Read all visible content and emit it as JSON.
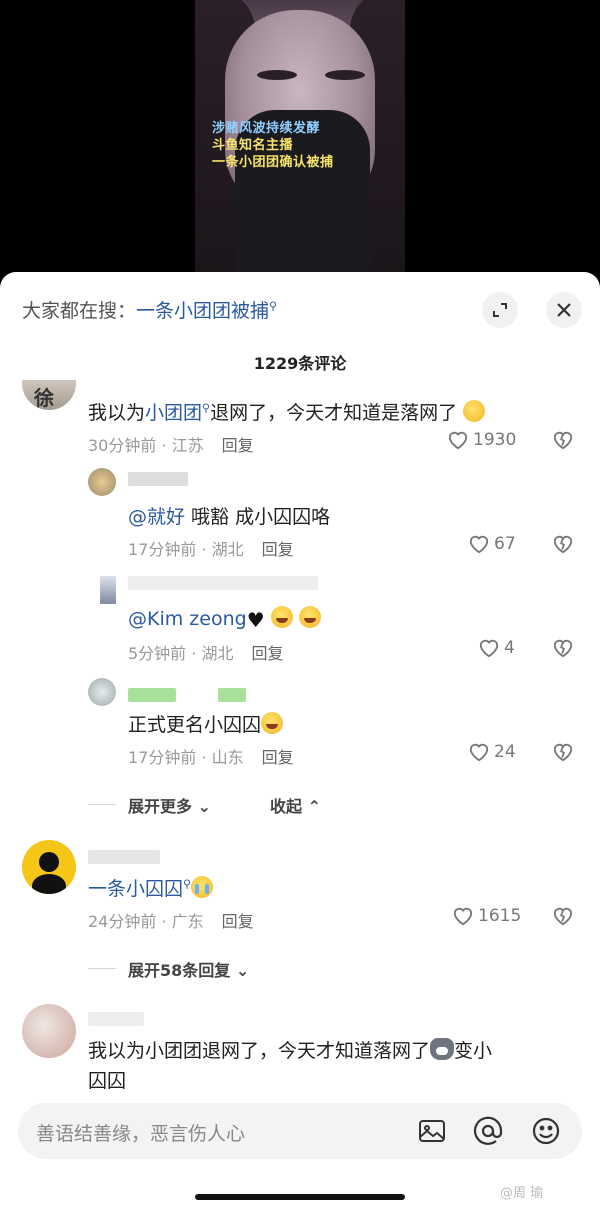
{
  "video": {
    "caption_lines": [
      "涉赌风波持续发酵",
      "斗鱼知名主播",
      "一条小团团确认被捕"
    ]
  },
  "sheet": {
    "search_prefix": "大家都在搜：",
    "search_term": "一条小团团被捕",
    "comment_count": "1229条评论"
  },
  "comments": [
    {
      "text_before": "我以为",
      "link": "小团团",
      "text_after": "退网了，今天才知道是落网了",
      "time": "30分钟前",
      "location": "江苏",
      "reply_label": "回复",
      "likes": "1930"
    },
    {
      "mention": "@就好",
      "text": " 哦豁 成小囚囚咯",
      "time": "17分钟前",
      "location": "湖北",
      "reply_label": "回复",
      "likes": "67"
    },
    {
      "mention": "@Kim zeong",
      "time": "5分钟前",
      "location": "湖北",
      "reply_label": "回复",
      "likes": "4"
    },
    {
      "text": "正式更名小囚囚",
      "time": "17分钟前",
      "location": "山东",
      "reply_label": "回复",
      "likes": "24"
    },
    {
      "text": "一条小囚囚",
      "time": "24分钟前",
      "location": "广东",
      "reply_label": "回复",
      "likes": "1615"
    },
    {
      "text_line1": "我以为小团团退网了，今天才知道落网了",
      "text_line1_tail": "变小",
      "text_line2": "囚囚"
    }
  ],
  "thread": {
    "expand_more": "展开更多",
    "collapse": "收起",
    "expand_replies": "展开58条回复"
  },
  "input": {
    "placeholder": "善语结善缘，恶言伤人心"
  },
  "watermark": "@周    瑜",
  "colors": {
    "link": "#2b5aa0",
    "muted": "#999999",
    "accent": "#222222"
  },
  "icons": [
    "expand-icon",
    "close-icon",
    "heart-outline-icon",
    "broken-heart-icon",
    "image-icon",
    "at-icon",
    "emoji-icon"
  ]
}
